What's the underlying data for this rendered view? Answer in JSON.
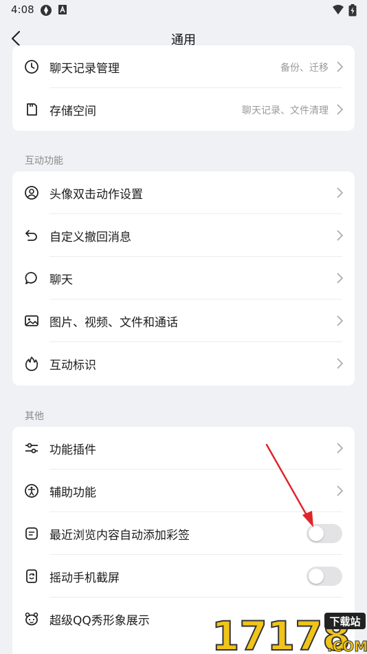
{
  "status": {
    "time": "4:08"
  },
  "nav": {
    "title": "通用"
  },
  "card1": {
    "items": [
      {
        "label": "聊天记录管理",
        "value": "备份、迁移"
      },
      {
        "label": "存储空间",
        "value": "聊天记录、文件清理"
      }
    ]
  },
  "section_interact": {
    "title": "互动功能",
    "items": [
      {
        "label": "头像双击动作设置"
      },
      {
        "label": "自定义撤回消息"
      },
      {
        "label": "聊天"
      },
      {
        "label": "图片、视频、文件和通话"
      },
      {
        "label": "互动标识"
      }
    ]
  },
  "section_other": {
    "title": "其他",
    "items": [
      {
        "label": "功能插件"
      },
      {
        "label": "辅助功能"
      },
      {
        "label": "最近浏览内容自动添加彩签",
        "toggle": false
      },
      {
        "label": "摇动手机截屏",
        "toggle": false
      },
      {
        "label": "超级QQ秀形象展示"
      }
    ]
  },
  "watermark": {
    "text": "17178",
    "badge": "下载站",
    "domain": ".COM"
  },
  "colors": {
    "background": "#f0f1f5",
    "toggle_off": "#e3e3e6",
    "annotation_arrow": "#e0242b"
  }
}
